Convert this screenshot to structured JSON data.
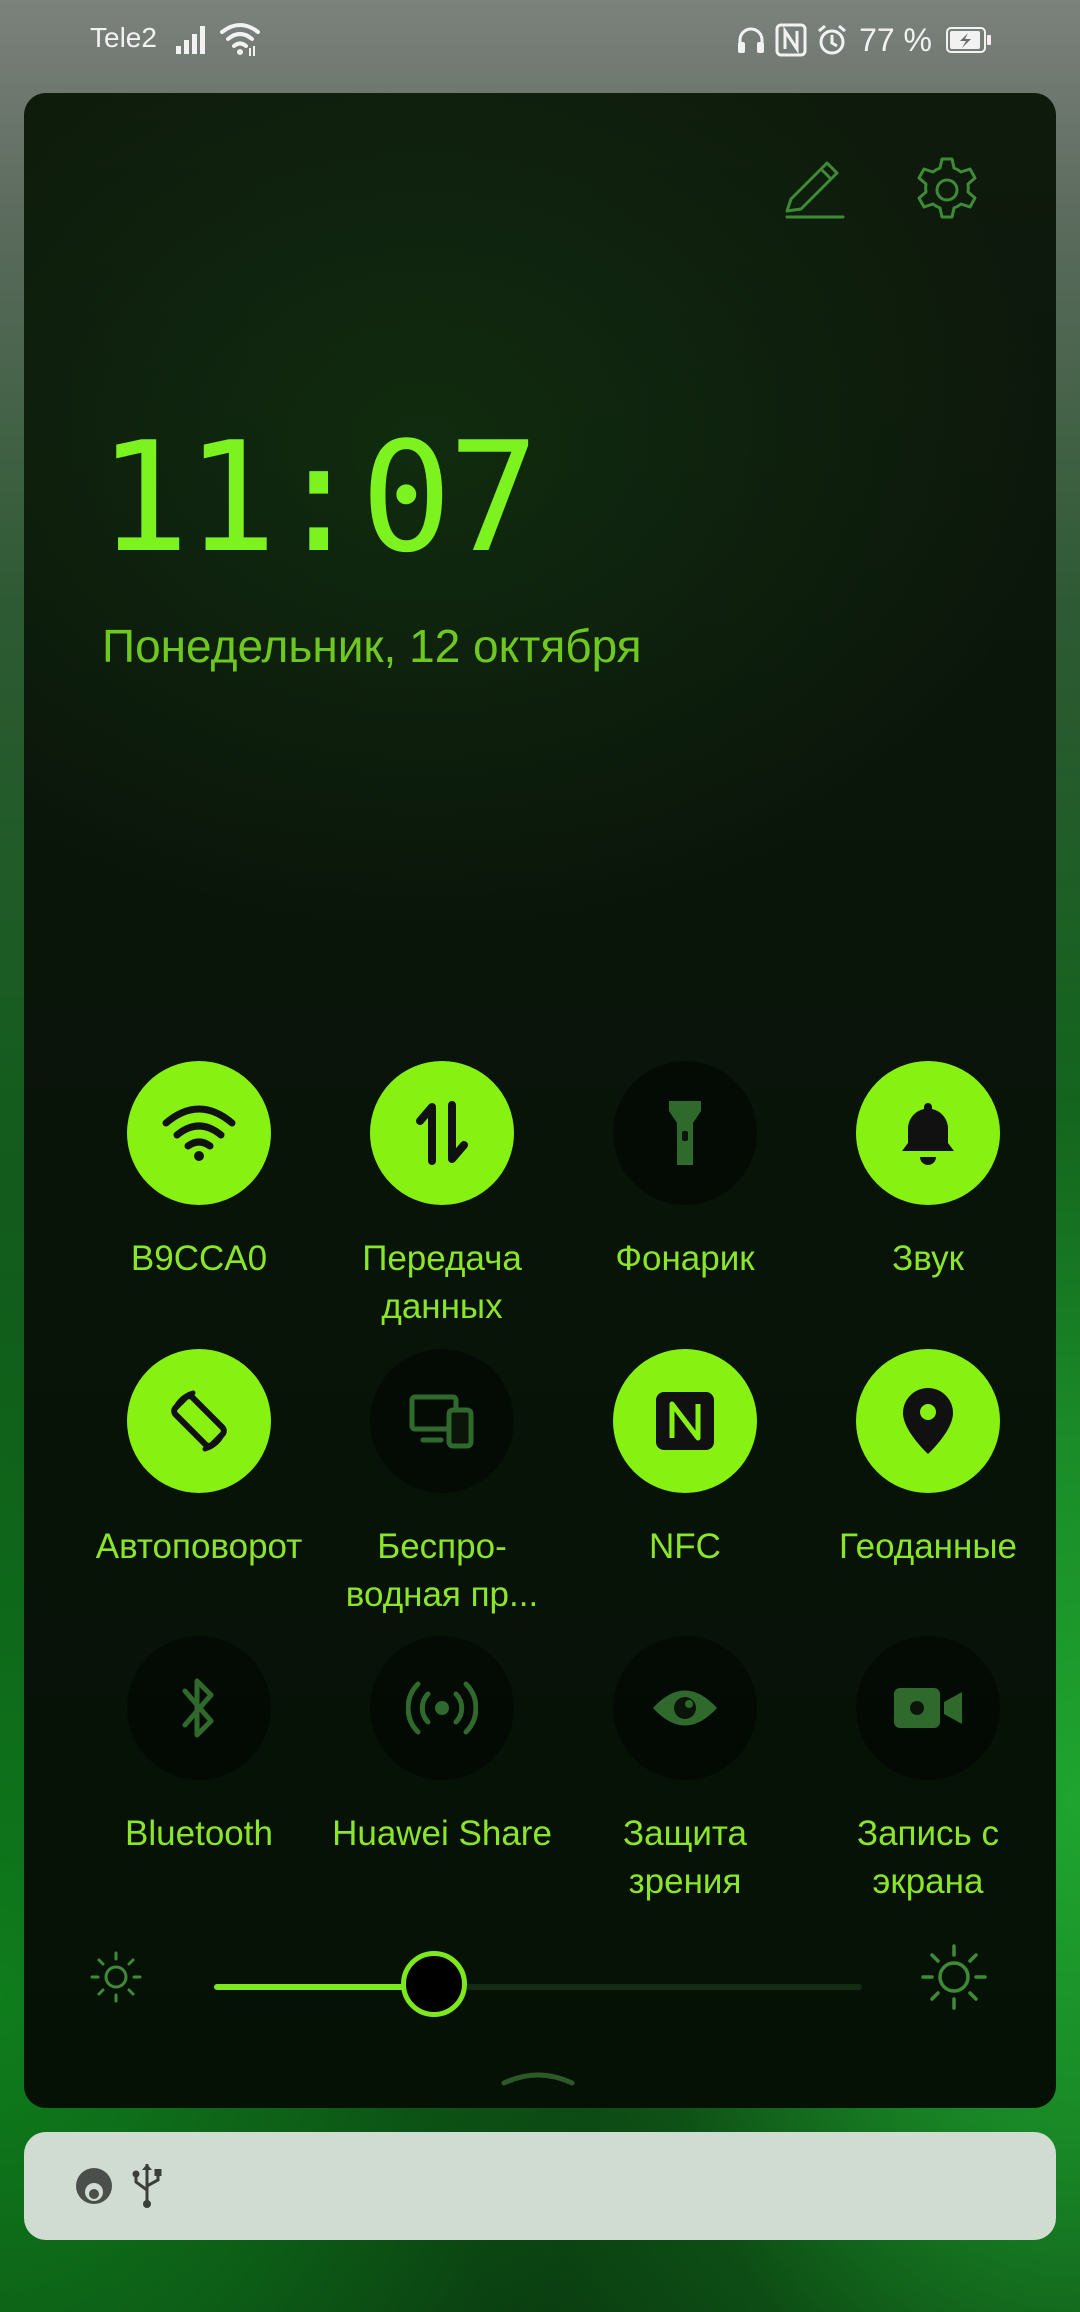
{
  "status_bar": {
    "carrier": "Tele2",
    "battery_percent": "77 %",
    "icons": [
      "signal-icon",
      "wifi-icon",
      "headphones-icon",
      "nfc-icon",
      "alarm-icon",
      "battery-charging-icon"
    ]
  },
  "panel": {
    "time": "11:07",
    "date": "Понедельник, 12 октября",
    "edit_icon": "pencil-icon",
    "settings_icon": "gear-icon"
  },
  "tiles": [
    {
      "label": "B9CCA0",
      "state": "on",
      "icon": "wifi-icon"
    },
    {
      "label": "Передача\nданных",
      "state": "on",
      "icon": "mobile-data-icon"
    },
    {
      "label": "Фонарик",
      "state": "off",
      "icon": "flashlight-icon"
    },
    {
      "label": "Звук",
      "state": "on",
      "icon": "bell-icon"
    },
    {
      "label": "Автоповорот",
      "state": "on",
      "icon": "auto-rotate-icon"
    },
    {
      "label": "Беспро-\nводная пр...",
      "state": "off",
      "icon": "wireless-projection-icon"
    },
    {
      "label": "NFC",
      "state": "on",
      "icon": "nfc-icon"
    },
    {
      "label": "Геоданные",
      "state": "on",
      "icon": "location-pin-icon"
    },
    {
      "label": "Bluetooth",
      "state": "off",
      "icon": "bluetooth-icon"
    },
    {
      "label": "Huawei Share",
      "state": "off",
      "icon": "huawei-share-icon"
    },
    {
      "label": "Защита\nзрения",
      "state": "off",
      "icon": "eye-icon"
    },
    {
      "label": "Запись с\nэкрана",
      "state": "off",
      "icon": "screen-record-icon"
    }
  ],
  "brightness": {
    "level": 0.34
  },
  "notification_bar": {
    "icons": [
      "app-status-icon",
      "usb-icon"
    ]
  },
  "colors": {
    "accent": "#87f212",
    "text_green": "#8be62a",
    "panel_bg": "#0a150a",
    "notification_bg": "#d0dcd2"
  }
}
